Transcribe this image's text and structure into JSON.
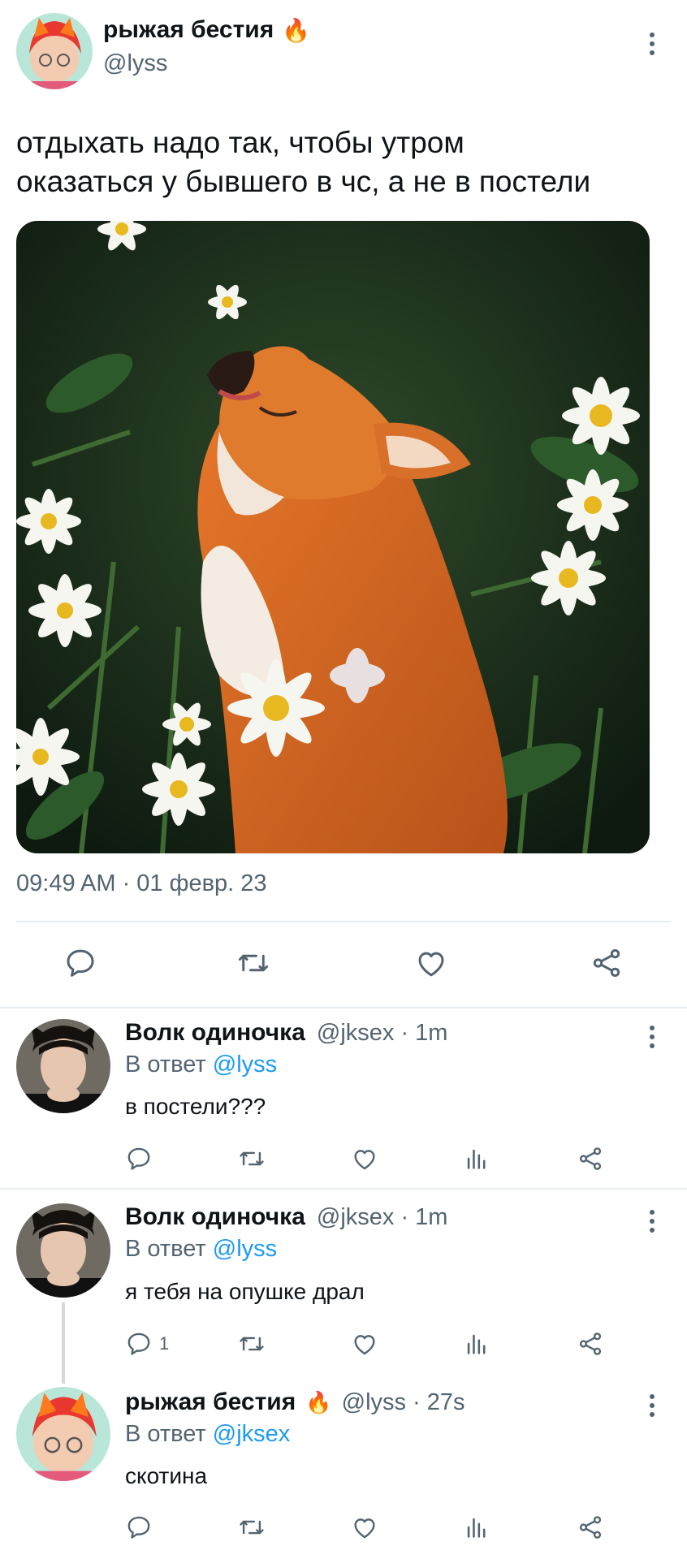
{
  "main_tweet": {
    "display_name": "рыжая бестия",
    "emoji": "🔥",
    "handle": "@lyss",
    "text_line1": "отдыхать надо так, чтобы утром",
    "text_line2": "оказаться у бывшего в чс, а не в постели",
    "timestamp": "09:49 AM · 01 февр. 23"
  },
  "replies": [
    {
      "display_name": "Волк одиночка",
      "handle_time": "@jksex · 1m",
      "reply_prefix": "В ответ",
      "reply_to": "@lyss",
      "text": "в постели???",
      "reply_count": ""
    },
    {
      "display_name": "Волк одиночка",
      "handle_time": "@jksex · 1m",
      "reply_prefix": "В ответ",
      "reply_to": "@lyss",
      "text": "я тебя на опушке драл",
      "reply_count": "1"
    },
    {
      "display_name": "рыжая бестия",
      "emoji": "🔥",
      "handle_time": "@lyss · 27s",
      "reply_prefix": "В ответ",
      "reply_to": "@jksex",
      "text": "скотина",
      "reply_count": ""
    }
  ],
  "icons": {
    "reply": "reply-icon",
    "retweet": "retweet-icon",
    "like": "heart-icon",
    "views": "views-icon",
    "share": "share-icon",
    "more": "more-icon"
  },
  "colors": {
    "text": "#0f1419",
    "muted": "#536471",
    "link": "#1d9bf0",
    "divider": "#e6ecf0"
  }
}
